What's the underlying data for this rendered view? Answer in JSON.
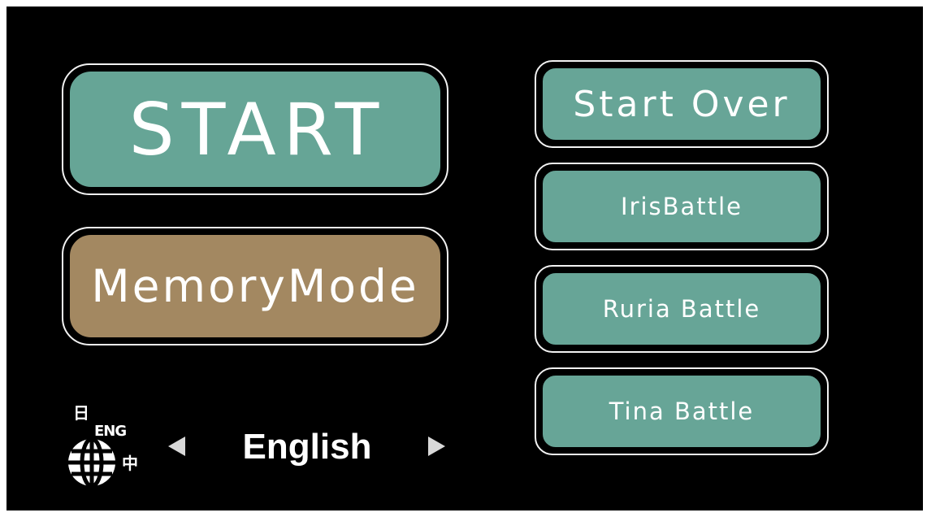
{
  "main_menu": {
    "start_label": "START",
    "memory_mode_label": "MemoryMode"
  },
  "battle_menu": {
    "items": [
      {
        "label": "Start Over"
      },
      {
        "label": "IrisBattle"
      },
      {
        "label": "Ruria Battle"
      },
      {
        "label": "Tina Battle"
      }
    ]
  },
  "language": {
    "icon_glyphs": {
      "japanese": "日",
      "english": "ENG",
      "chinese": "中"
    },
    "current": "English"
  },
  "colors": {
    "background": "#000000",
    "teal_button": "#66a596",
    "tan_button": "#a38861",
    "text": "#ffffff"
  },
  "icons": [
    "language-globe-icon",
    "arrow-left-icon",
    "arrow-right-icon"
  ]
}
